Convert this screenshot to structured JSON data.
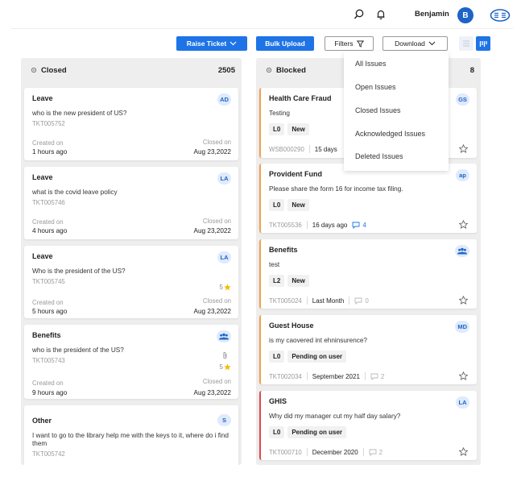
{
  "header": {
    "user_name": "Benjamin",
    "avatar_initial": "B"
  },
  "toolbar": {
    "raise_ticket": "Raise Ticket",
    "bulk_upload": "Bulk Upload",
    "filters": "Filters",
    "download": "Download"
  },
  "download_menu": [
    "All Issues",
    "Open Issues",
    "Closed Issues",
    "Acknowledged Issues",
    "Deleted Issues"
  ],
  "columns": [
    {
      "title": "Closed",
      "count": "2505",
      "cards": [
        {
          "title": "Leave",
          "desc": "who is the new president of US?",
          "ticket": "TKT005752",
          "badge": "AD",
          "created_label": "Created on",
          "created_value": "1 hours ago",
          "closed_label": "Closed on",
          "closed_value": "Aug 23,2022"
        },
        {
          "title": "Leave",
          "desc": "what is the covid leave policy",
          "ticket": "TKT005746",
          "badge": "LA",
          "created_label": "Created on",
          "created_value": "4 hours ago",
          "closed_label": "Closed on",
          "closed_value": "Aug 23,2022"
        },
        {
          "title": "Leave",
          "desc": "Who is the president of the US?",
          "ticket": "TKT005745",
          "badge": "LA",
          "rating": "5",
          "created_label": "Created on",
          "created_value": "5 hours ago",
          "closed_label": "Closed on",
          "closed_value": "Aug 23,2022"
        },
        {
          "title": "Benefits",
          "desc": "who is the president of the US?",
          "ticket": "TKT005743",
          "badge_icon": "group-icon",
          "rating": "5",
          "created_label": "Created on",
          "created_value": "9 hours ago",
          "closed_label": "Closed on",
          "closed_value": "Aug 23,2022"
        },
        {
          "title": "Other",
          "desc": "I want to go to the library help me with the keys to it, where do i find them",
          "ticket": "TKT005742",
          "badge": "S"
        }
      ]
    },
    {
      "title": "Blocked",
      "count": "8",
      "cards": [
        {
          "title": "Health Care Fraud",
          "desc": "Testing",
          "level": "L0",
          "status": "New",
          "ticket": "WSB000290",
          "age": "15 days",
          "badge": "GS"
        },
        {
          "title": "Provident Fund",
          "desc": "Please share the form 16 for income tax filing.",
          "level": "L0",
          "status": "New",
          "ticket": "TKT005536",
          "age": "16 days ago",
          "comments": "4",
          "badge": "ap"
        },
        {
          "title": "Benefits",
          "desc": "test",
          "level": "L2",
          "status": "New",
          "ticket": "TKT005024",
          "age": "Last Month",
          "comments": "0",
          "badge_icon": "group-icon"
        },
        {
          "title": "Guest House",
          "desc": "is my caovered int ehninsurence?",
          "level": "L0",
          "status": "Pending on user",
          "ticket": "TKT002034",
          "age": "September 2021",
          "comments": "2",
          "badge": "MD"
        },
        {
          "title": "GHIS",
          "desc": "Why did my manager cut my half day salary?",
          "level": "L0",
          "status": "Pending on user",
          "ticket": "TKT000710",
          "age": "December 2020",
          "comments": "2",
          "badge": "LA"
        }
      ]
    }
  ],
  "colors": {
    "primary": "#1e74e6",
    "badge_bg": "#dfeafb",
    "accent_orange": "#f2a24a",
    "accent_red": "#e04a4a",
    "star": "#f5b800"
  }
}
